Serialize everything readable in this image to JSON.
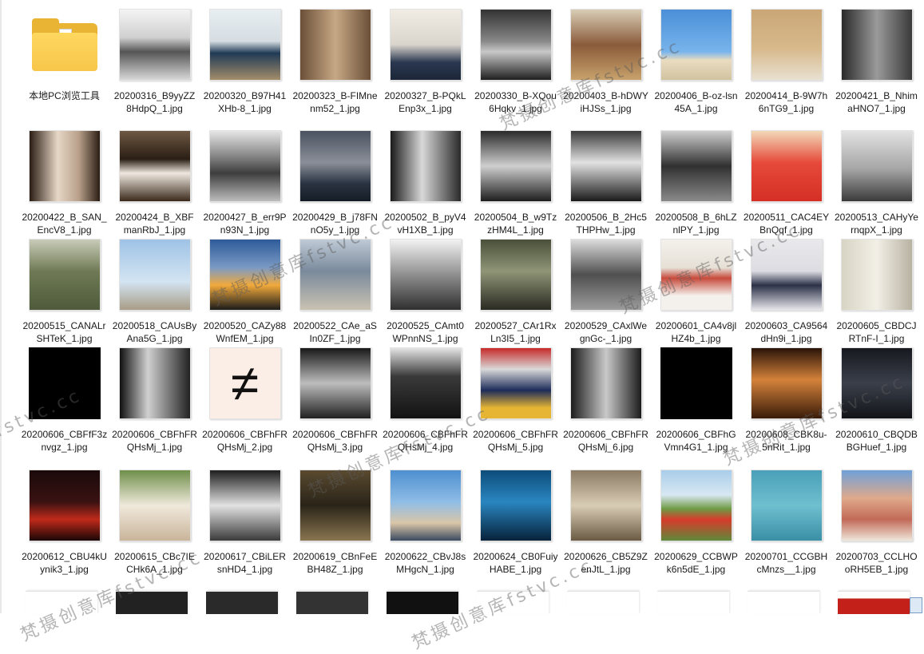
{
  "explorer": {
    "items": [
      {
        "name": "本地PC浏览工具",
        "type": "folder"
      },
      {
        "name": "20200316_B9yyZZ8HdpQ_1.jpg",
        "bg": "linear-gradient(#f4f4f4 0%, #cfcfcf 40%, #555 60%, #d8d8d8 100%)"
      },
      {
        "name": "20200320_B97H41XHb-8_1.jpg",
        "bg": "linear-gradient(#e8eef2 0%, #d5dde2 45%, #1f3a55 62%, #a48d6a 100%)"
      },
      {
        "name": "20200323_B-FIMnenm52_1.jpg",
        "bg": "linear-gradient(90deg, #6b5038, #c7a885 50%, #6b5038)"
      },
      {
        "name": "20200327_B-PQkLEnp3x_1.jpg",
        "bg": "linear-gradient(#f2ede4 0%, #d9d4cc 50%, #2a3850 75%, #1c2638 100%)"
      },
      {
        "name": "20200330_B-XQou6Hqkv_1.jpg",
        "bg": "linear-gradient(#333 0%, #888 45%, #c8c8c8 60%, #1f1f1f 100%)"
      },
      {
        "name": "20200403_B-hDWYiHJSs_1.jpg",
        "bg": "linear-gradient(#d9cdb6 0%, #8a5b3a 50%, #c8a26c 100%)"
      },
      {
        "name": "20200406_B-oz-lsn45A_1.jpg",
        "bg": "linear-gradient(#4a8fd8 0%, #78b4ec 60%, #e9dcc0 72%, #d2c2a0 100%)"
      },
      {
        "name": "20200414_B-9W7h6nTG9_1.jpg",
        "bg": "linear-gradient(#caa676 0%, #d7b98b 55%, #e8e0d0 100%)"
      },
      {
        "name": "20200421_B_NhimaHNO7_1.jpg",
        "bg": "linear-gradient(90deg, #2a2a2a, #9a9a9a 50%, #3a3a3a)"
      },
      {
        "name": "20200422_B_SAN_EncV8_1.jpg",
        "bg": "linear-gradient(90deg, #2b1d14 0%, #e6d7c6 40%, #b8a08a 70%, #2b1d14 100%)"
      },
      {
        "name": "20200424_B_XBFmanRbJ_1.jpg",
        "bg": "linear-gradient(#6e5843 0%, #2a1e14 40%, #efe8e0 60%, #3b2a1c 100%)"
      },
      {
        "name": "20200427_B_err9Pn93N_1.jpg",
        "bg": "linear-gradient(#e6e6e6 0%, #7a7a7a 40%, #3d3d3d 60%, #bdbdbd 100%)"
      },
      {
        "name": "20200429_B_j78FNnO5y_1.jpg",
        "bg": "linear-gradient(#4a5260 0%, #8b8f98 45%, #2a3342 75%, #151c26 100%)"
      },
      {
        "name": "20200502_B_pyV4vH1XB_1.jpg",
        "bg": "linear-gradient(90deg, #1a1a1a, #d8d8d8 45%, #2a2a2a)"
      },
      {
        "name": "20200504_B_w9TzzHM4L_1.jpg",
        "bg": "linear-gradient(#2a2a2a 0%, #cfcfcf 50%, #1e1e1e 100%)"
      },
      {
        "name": "20200506_B_2Hc5THPHw_1.jpg",
        "bg": "linear-gradient(#3a3a3a 0%, #e2e2e2 45%, #1a1a1a 100%)"
      },
      {
        "name": "20200508_B_6hLZnlPY_1.jpg",
        "bg": "linear-gradient(#cfcfcf 0%, #303030 50%, #8a8a8a 100%)"
      },
      {
        "name": "20200511_CAC4EYBnQqf_1.jpg",
        "bg": "linear-gradient(#f2d9b8 0%, #e64a3a 45%, #d52f25 100%)"
      },
      {
        "name": "20200513_CAHyYernqpX_1.jpg",
        "bg": "linear-gradient(#e2e2e2 0%, #a4a4a4 55%, #3a3a3a 100%)"
      },
      {
        "name": "20200515_CANALrSHTeK_1.jpg",
        "bg": "linear-gradient(#c8cbb8 0%, #6f7a55 45%, #4e5a3a 100%)"
      },
      {
        "name": "20200518_CAUsByAna5G_1.jpg",
        "bg": "linear-gradient(#9ec3e6 0%, #d3e4f2 60%, #a89c86 100%)"
      },
      {
        "name": "20200520_CAZy88WnfEM_1.jpg",
        "bg": "linear-gradient(#2d5b9a 0%, #7b9ac4 40%, #f1a93b 65%, #1a1a1a 100%)"
      },
      {
        "name": "20200522_CAe_aSIn0ZF_1.jpg",
        "bg": "linear-gradient(#bfcad6 0%, #7a8a9c 45%, #c9c2b2 100%)"
      },
      {
        "name": "20200525_CAmt0WPnnNS_1.jpg",
        "bg": "linear-gradient(#f2f2f2 0%, #8f8f8f 50%, #2f2f2f 100%)"
      },
      {
        "name": "20200527_CAr1RxLn3I5_1.jpg",
        "bg": "linear-gradient(#4a4f3a 0%, #8f9576 45%, #2a2a22 100%)"
      },
      {
        "name": "20200529_CAxlWegnGc-_1.jpg",
        "bg": "linear-gradient(#dcdcdc 0%, #4f4f4f 50%, #9c9c9c 100%)"
      },
      {
        "name": "20200601_CA4v8jlHZ4b_1.jpg",
        "bg": "linear-gradient(#f4f1ec 0%, #e6e0d6 40%, #c74b3c 55%, #f4f1ec 80%)"
      },
      {
        "name": "20200603_CA9564dHn9i_1.jpg",
        "bg": "linear-gradient(#e9e9ec 0%, #dcdce2 45%, #2c3148 65%, #e6e6ea 100%)"
      },
      {
        "name": "20200605_CBDCJRTnF-I_1.jpg",
        "bg": "linear-gradient(90deg, #d8d4c4, #f2efe6 50%, #b8b2a2)"
      },
      {
        "name": "20200606_CBFfF3znvgz_1.jpg",
        "bg": "#000000",
        "noborder": true
      },
      {
        "name": "20200606_CBFhFRQHsMj_1.jpg",
        "bg": "linear-gradient(90deg, #111 0%, #d0d0d0 40%, #222 100%)"
      },
      {
        "name": "20200606_CBFhFRQHsMj_2.jpg",
        "bg": "#fbeee6",
        "glyph": "≠"
      },
      {
        "name": "20200606_CBFhFRQHsMj_3.jpg",
        "bg": "linear-gradient(#181818 0%, #bdbdbd 50%, #202020 100%)"
      },
      {
        "name": "20200606_CBFhFRQHsMj_4.jpg",
        "bg": "linear-gradient(#e4e4e4 0%, #3a3a3a 40%, #121212 100%)"
      },
      {
        "name": "20200606_CBFhFRQHsMj_5.jpg",
        "bg": "linear-gradient(#c62a2a 0%, #d9d9d9 30%, #1d2c5a 60%, #e6b533 85%)"
      },
      {
        "name": "20200606_CBFhFRQHsMj_6.jpg",
        "bg": "linear-gradient(90deg, #1c1c1c, #c9c9c9 50%, #1c1c1c)"
      },
      {
        "name": "20200606_CBFhGVmn4G1_1.jpg",
        "bg": "#000000",
        "noborder": true
      },
      {
        "name": "20200608_CBK8u-5nRit_1.jpg",
        "bg": "linear-gradient(#2a1408 0%, #d4823a 45%, #3a1c0a 100%)"
      },
      {
        "name": "20200610_CBQDBBGHuef_1.jpg",
        "bg": "linear-gradient(#17191f 0%, #3a3f4a 50%, #121418 100%)"
      },
      {
        "name": "20200612_CBU4kUynik3_1.jpg",
        "bg": "linear-gradient(#1a0a0a 0%, #3a1212 45%, #c02a1a 70%, #1a0606 100%)"
      },
      {
        "name": "20200615_CBc7IECHk6A_1.jpg",
        "bg": "linear-gradient(#6f8f4a 0%, #f0e9dc 50%, #c9b49a 100%)"
      },
      {
        "name": "20200617_CBiLERsnHD4_1.jpg",
        "bg": "linear-gradient(#1e1e1e 0%, #e2e2e2 50%, #3a3a3a 100%)"
      },
      {
        "name": "20200619_CBnFeEBH48Z_1.jpg",
        "bg": "linear-gradient(#5a4a30 0%, #2a2418 50%, #8a7550 100%)"
      },
      {
        "name": "20200622_CBvJ8sMHgcN_1.jpg",
        "bg": "linear-gradient(#4d8fd0 0%, #8fbde6 45%, #dac6a8 75%, #3a4a60 100%)"
      },
      {
        "name": "20200624_CB0FuiyHABE_1.jpg",
        "bg": "linear-gradient(#0c4c7a 0%, #2a86c0 45%, #06223a 100%)"
      },
      {
        "name": "20200626_CB5Z9ZenJtL_1.jpg",
        "bg": "linear-gradient(#8b7b64 0%, #d9ccb4 50%, #6a5a44 100%)"
      },
      {
        "name": "20200629_CCBWPk6n5dE_1.jpg",
        "bg": "linear-gradient(#a9cdea 0%, #d8e8f2 35%, #6e9a44 55%, #d83a2a 70%, #5e8a3a 100%)"
      },
      {
        "name": "20200701_CCGBHcMnzs__1.jpg",
        "bg": "linear-gradient(#4aa0b8 0%, #6fc0cf 50%, #3a8fa6 100%)"
      },
      {
        "name": "20200703_CCLHOoRH5EB_1.jpg",
        "bg": "linear-gradient(#6fa0d8 0%, #e0a98a 40%, #c26a58 70%, #efe6da 100%)"
      }
    ]
  },
  "watermark": {
    "text_1": "梵摄创意库fstvc.cc",
    "text_2": "梵摄创意库fstvc.cc",
    "text_3": "梵摄创意库fstvc.cc",
    "text_4": "梵摄创意库fstvc.cc",
    "text_5": "梵摄创意库fstvc.cc",
    "text_6": "fstvc.cc",
    "text_7": "梵摄创意库fstvc.cc",
    "text_8": "梵摄创意库fstvc.cc"
  }
}
